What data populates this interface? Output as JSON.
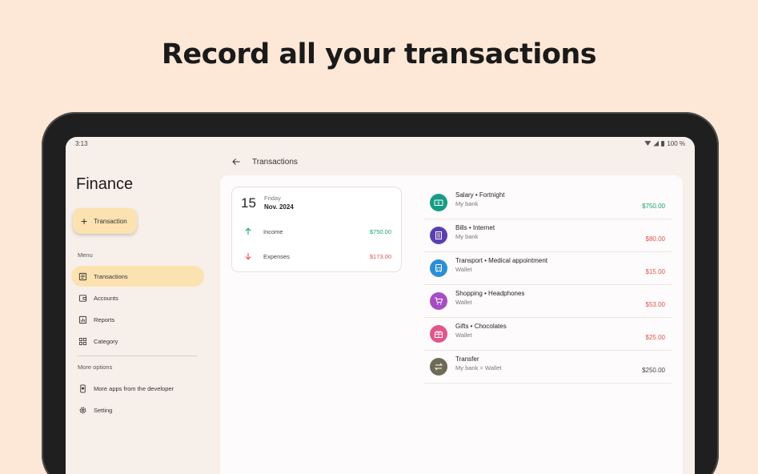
{
  "headline": "Record all your transactions",
  "status": {
    "time": "3:13",
    "battery": "100 %"
  },
  "sidebar": {
    "app_title": "Finance",
    "fab_label": "Transaction",
    "menu_label": "Menu",
    "items": [
      {
        "label": "Transactions",
        "icon": "list-icon"
      },
      {
        "label": "Accounts",
        "icon": "wallet-icon"
      },
      {
        "label": "Reports",
        "icon": "chart-icon"
      },
      {
        "label": "Category",
        "icon": "grid-icon"
      }
    ],
    "more_label": "More options",
    "more_items": [
      {
        "label": "More apps from the developer",
        "icon": "phone-icon"
      },
      {
        "label": "Setting",
        "icon": "gear-icon"
      }
    ]
  },
  "topbar": {
    "title": "Transactions"
  },
  "day_summary": {
    "day_number": "15",
    "day_name": "Friday",
    "month_year": "Nov. 2024",
    "income_label": "Income",
    "income_value": "$750.00",
    "expenses_label": "Expenses",
    "expenses_value": "$173.00"
  },
  "transactions": [
    {
      "title": "Salary • Fortnight",
      "account": "My bank",
      "amount": "$750.00",
      "kind": "income",
      "icon": "money-icon",
      "color": "#179c84"
    },
    {
      "title": "Bills • Internet",
      "account": "My bank",
      "amount": "$80.00",
      "kind": "expense",
      "icon": "receipt-icon",
      "color": "#5b3fb0"
    },
    {
      "title": "Transport • Medical appointment",
      "account": "Wallet",
      "amount": "$15.00",
      "kind": "expense",
      "icon": "bus-icon",
      "color": "#2a8fd6"
    },
    {
      "title": "Shopping • Headphones",
      "account": "Wallet",
      "amount": "$53.00",
      "kind": "expense",
      "icon": "cart-icon",
      "color": "#a64dc4"
    },
    {
      "title": "Gifts • Chocolates",
      "account": "Wallet",
      "amount": "$25.00",
      "kind": "expense",
      "icon": "gift-icon",
      "color": "#e0568a"
    },
    {
      "title": "Transfer",
      "account": "My bank > Wallet",
      "amount": "$250.00",
      "kind": "transfer",
      "icon": "transfer-icon",
      "color": "#6f6a56"
    }
  ]
}
